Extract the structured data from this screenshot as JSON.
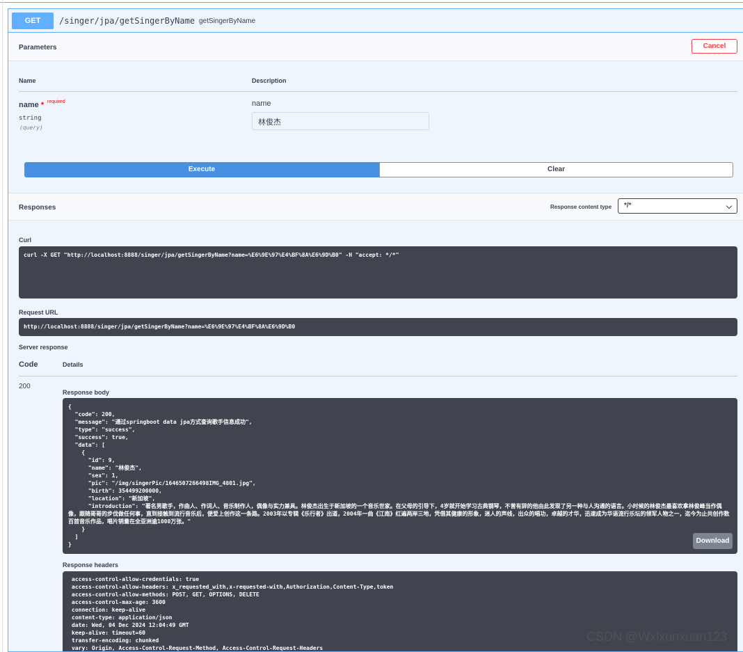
{
  "operation": {
    "method": "GET",
    "path": "/singer/jpa/getSingerByName",
    "operation_id": "getSingerByName"
  },
  "parameters": {
    "title": "Parameters",
    "cancel_label": "Cancel",
    "headers": {
      "name": "Name",
      "description": "Description"
    },
    "items": [
      {
        "name": "name",
        "required_star": "*",
        "required_text": "required",
        "type": "string",
        "in": "(query)",
        "description": "name",
        "value": "林俊杰"
      }
    ]
  },
  "actions": {
    "execute_label": "Execute",
    "clear_label": "Clear"
  },
  "responses": {
    "title": "Responses",
    "content_type_label": "Response content type",
    "content_type_value": "*/*"
  },
  "curl": {
    "label": "Curl",
    "command": "curl -X GET \"http://localhost:8888/singer/jpa/getSingerByName?name=%E6%9E%97%E4%BF%8A%E6%9D%B0\" -H \"accept: */*\""
  },
  "request_url": {
    "label": "Request URL",
    "value": "http://localhost:8888/singer/jpa/getSingerByName?name=%E6%9E%97%E4%BF%8A%E6%9D%B0"
  },
  "server_response": {
    "label": "Server response",
    "code_header": "Code",
    "details_header": "Details",
    "status_code": "200",
    "body_label": "Response body",
    "body": "{\n  \"code\": 200,\n  \"message\": \"通过springboot data jpa方式查询歌手信息成功\",\n  \"type\": \"success\",\n  \"success\": true,\n  \"data\": [\n    {\n      \"id\": 9,\n      \"name\": \"林俊杰\",\n      \"sex\": 1,\n      \"pic\": \"/img/singerPic/1646507266498IMG_4801.jpg\",\n      \"birth\": 354499200000,\n      \"location\": \"新加坡\",\n      \"introduction\": \"著名男歌手，作曲人、作词人、音乐制作人，偶像与实力兼具。林俊杰出生于新加坡的一个音乐世家。在父母的引导下，4岁就开始学习古典钢琴，不曾有辞的他由此发现了另一种与人沟通的语言。小时候的林俊杰最喜欢拿林俊峰当作偶像，跟随哥哥的步伐做任何事，直到接触到流行音乐后，便爱上创作这一条路。2003年以专辑《乐行者》出道，2004年一曲《江南》红遍两岸三地，凭借其健康的形象，迷人的声线，出众的唱功，卓越的才华，迅速成为华语流行乐坛的领军人物之一，迄今为止共创作数百首音乐作品，唱片销量在全亚洲逾1000万张。\"\n    }\n  ]\n}",
    "download_label": "Download",
    "headers_label": "Response headers",
    "headers_text": "access-control-allow-credentials: true\naccess-control-allow-headers: x_requested_with,x-requested-with,Authorization,Content-Type,token\naccess-control-allow-methods: POST, GET, OPTIONS, DELETE\naccess-control-max-age: 3600\nconnection: keep-alive\ncontent-type: application/json\ndate: Wed, 04 Dec 2024 12:04:49 GMT\nkeep-alive: timeout=60\ntransfer-encoding: chunked\nvary: Origin, Access-Control-Request-Method, Access-Control-Request-Headers"
  },
  "watermark": "CSDN @Wxlxunxuan123",
  "colors": {
    "get_method": "#61affe",
    "execute": "#4990e2",
    "cancel": "#f93e3e",
    "code_background": "#41444e",
    "download": "#7d8492"
  }
}
